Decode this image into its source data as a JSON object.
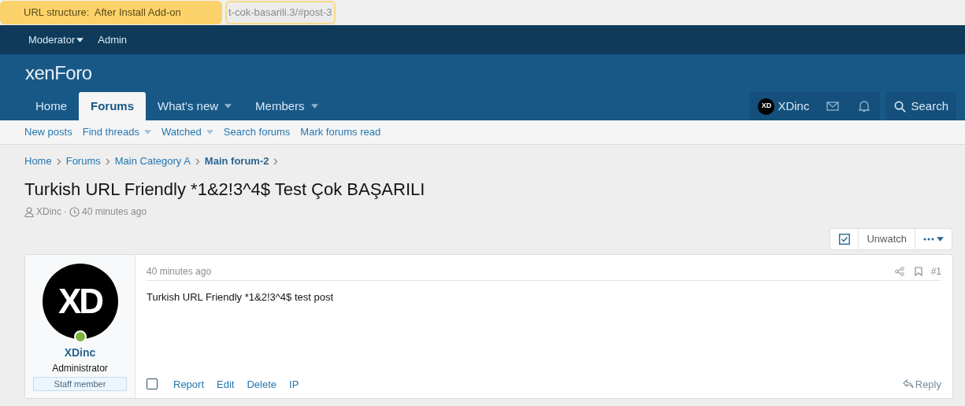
{
  "banner": {
    "label": "URL structure:  After Install Add-on",
    "url": "t-cok-basarili.3/#post-3"
  },
  "staff_bar": [
    {
      "label": "Moderator",
      "dropdown": true
    },
    {
      "label": "Admin",
      "dropdown": false
    }
  ],
  "logo": "xenForo",
  "nav_tabs": [
    {
      "label": "Home",
      "selected": false,
      "dropdown": false
    },
    {
      "label": "Forums",
      "selected": true,
      "dropdown": false
    },
    {
      "label": "What's new",
      "selected": false,
      "dropdown": true
    },
    {
      "label": "Members",
      "selected": false,
      "dropdown": true
    }
  ],
  "account": {
    "avatar": "XD",
    "name": "XDinc"
  },
  "search_label": "Search",
  "sub_nav": [
    {
      "label": "New posts",
      "dropdown": false
    },
    {
      "label": "Find threads",
      "dropdown": true
    },
    {
      "label": "Watched",
      "dropdown": true
    },
    {
      "label": "Search forums",
      "dropdown": false
    },
    {
      "label": "Mark forums read",
      "dropdown": false
    }
  ],
  "breadcrumbs": [
    {
      "label": "Home",
      "current": false
    },
    {
      "label": "Forums",
      "current": false
    },
    {
      "label": "Main Category A",
      "current": false
    },
    {
      "label": "Main forum-2",
      "current": true
    }
  ],
  "thread": {
    "title": "Turkish URL Friendly *1&2!3^4$ Test Çok BAŞARILI",
    "author": "XDinc",
    "separator": "·",
    "time": "40 minutes ago"
  },
  "watch": {
    "checked": true,
    "label": "Unwatch"
  },
  "post": {
    "time": "40 minutes ago",
    "number": "#1",
    "body": "Turkish URL Friendly *1&2!3^4$ test post",
    "selected": false,
    "user": {
      "avatar": "XD",
      "name": "XDinc",
      "title": "Administrator",
      "banner": "Staff member",
      "online": true
    },
    "actions": [
      "Report",
      "Edit",
      "Delete",
      "IP"
    ],
    "reply": "Reply"
  }
}
